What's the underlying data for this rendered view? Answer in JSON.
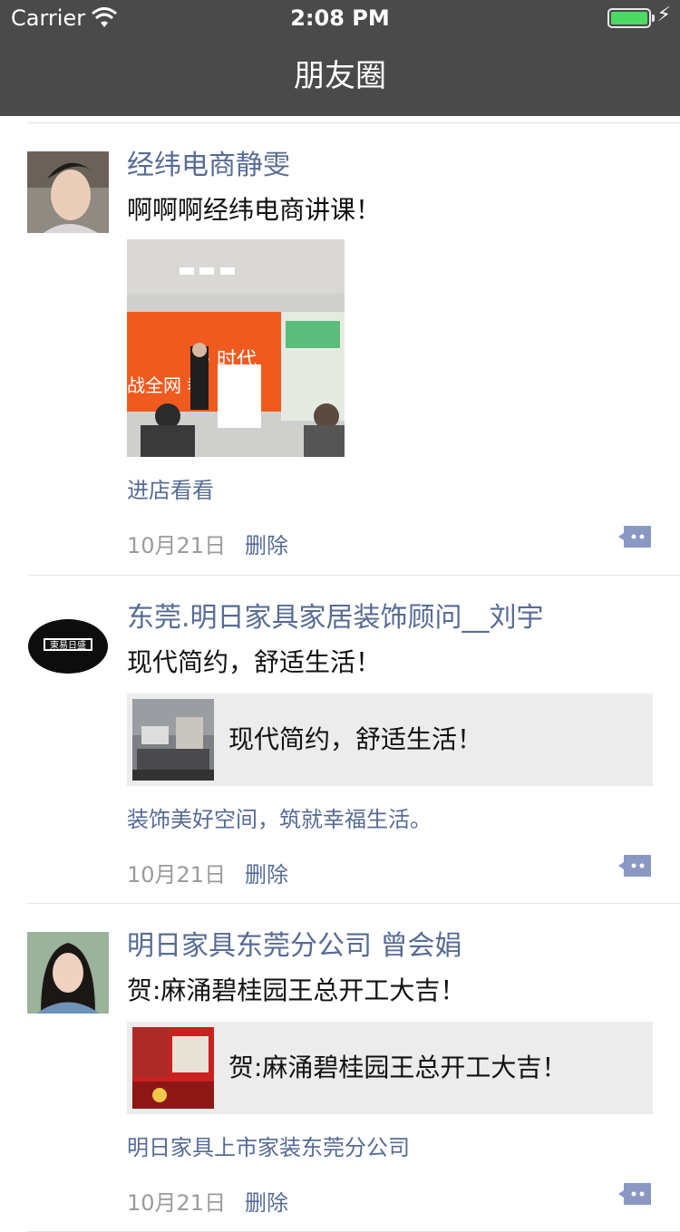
{
  "status": {
    "carrier": "Carrier",
    "time": "2:08 PM",
    "battery_level": 1.0
  },
  "nav": {
    "title": "朋友圈"
  },
  "posts": [
    {
      "author": "经纬电商静雯",
      "text": "啊啊啊经纬电商讲课！",
      "source": "进店看看",
      "date": "10月21日",
      "delete": "删除"
    },
    {
      "author": "东莞.明日家具家居装饰顾问__刘宇",
      "text": "现代简约，舒适生活！",
      "card_title": "现代简约，舒适生活！",
      "source": "装饰美好空间，筑就幸福生活。",
      "date": "10月21日",
      "delete": "删除"
    },
    {
      "author": "明日家具东莞分公司 曾会娟",
      "text": "贺:麻涌碧桂园王总开工大吉！",
      "card_title": "贺:麻涌碧桂园王总开工大吉！",
      "source": "明日家具上市家装东莞分公司",
      "date": "10月21日",
      "delete": "删除"
    }
  ],
  "colors": {
    "link": "#576b95",
    "bar": "#4a4a4a",
    "card": "#ececec",
    "comment_icon": "#8a98c4"
  }
}
